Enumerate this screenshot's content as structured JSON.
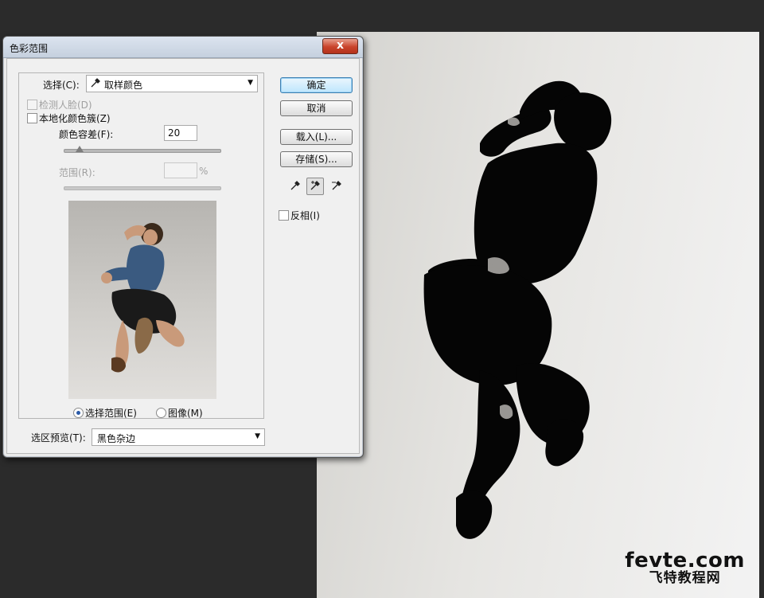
{
  "dialog": {
    "title": "色彩范围",
    "close_label": "x",
    "select_label": "选择(C):",
    "select_value": "取样颜色",
    "detect_faces_label": "检测人脸(D)",
    "localized_label": "本地化颜色簇(Z)",
    "fuzziness_label": "颜色容差(F):",
    "fuzziness_value": "20",
    "fuzziness_level": 0.1,
    "range_label": "范围(R):",
    "range_unit": "%",
    "radio_selection_label": "选择范围(E)",
    "radio_image_label": "图像(M)",
    "selection_preview_label": "选区预览(T):",
    "selection_preview_value": "黑色杂边",
    "buttons": {
      "ok": "确定",
      "cancel": "取消",
      "load": "载入(L)...",
      "save": "存储(S)..."
    },
    "invert_label": "反相(I)",
    "eyedroppers": [
      "eyedropper-icon",
      "eyedropper-plus-icon",
      "eyedropper-minus-icon"
    ]
  },
  "watermark": {
    "top": "fevte.com",
    "bottom": "飞特教程网"
  },
  "colors": {
    "background": "#2b2b2b",
    "dialog": "#f0f0f0",
    "close_button": "#c9432b",
    "accent": "#3c7fb1"
  }
}
